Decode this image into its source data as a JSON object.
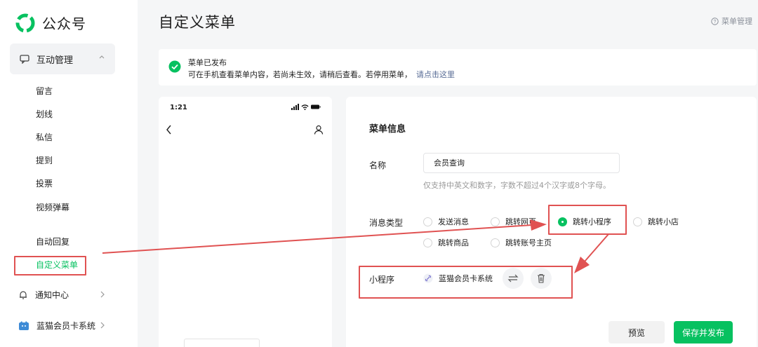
{
  "app": {
    "name": "公众号"
  },
  "sidebar": {
    "group": {
      "label": "互动管理"
    },
    "sub_items": [
      "留言",
      "划线",
      "私信",
      "提到",
      "投票",
      "视频弹幕"
    ],
    "auto_reply": "自动回复",
    "custom_menu": "自定义菜单",
    "notify": "通知中心",
    "member": "蓝猫会员卡系统"
  },
  "header": {
    "title": "自定义菜单",
    "help": "菜单管理"
  },
  "notice": {
    "title": "菜单已发布",
    "desc": "可在手机查看菜单内容，若尚未生效，请稍后查看。若停用菜单，",
    "link": "请点击这里"
  },
  "phone": {
    "time": "1:21"
  },
  "form": {
    "section_title": "菜单信息",
    "name_label": "名称",
    "name_value": "会员查询",
    "name_hint": "仅支持中英文和数字，字数不超过4个汉字或8个字母。",
    "type_label": "消息类型",
    "options": [
      "发送消息",
      "跳转网页",
      "跳转小程序",
      "跳转小店",
      "跳转商品",
      "跳转账号主页"
    ],
    "selected_option": "跳转小程序",
    "miniprogram_label": "小程序",
    "miniprogram_name": "蓝猫会员卡系统"
  },
  "actions": {
    "preview": "预览",
    "publish": "保存并发布"
  },
  "colors": {
    "accent": "#07c160",
    "annotation": "#e05252",
    "link": "#576b95"
  }
}
